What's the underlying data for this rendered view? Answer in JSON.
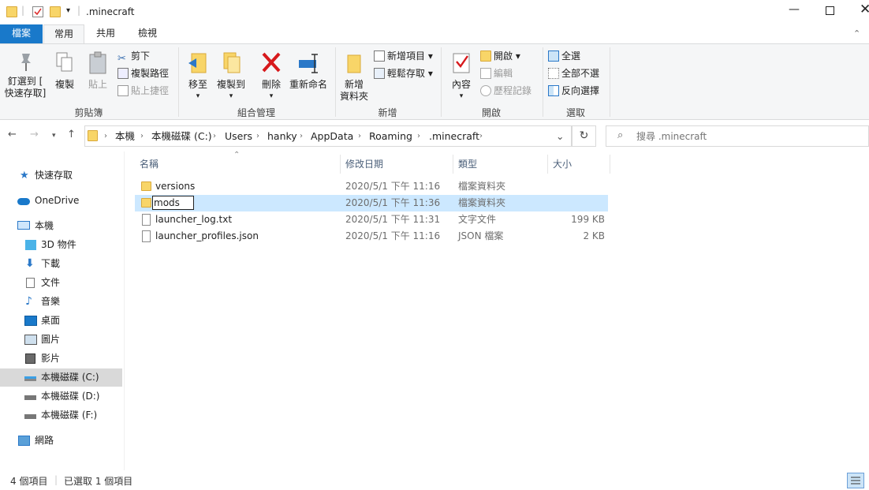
{
  "window": {
    "title": ".minecraft"
  },
  "ribbon_tabs": [
    "檔案",
    "常用",
    "共用",
    "檢視"
  ],
  "clipboard": {
    "pin_line1": "釘選到 [",
    "pin_line2": "快速存取]",
    "copy": "複製",
    "paste": "貼上",
    "cut": "剪下",
    "copy_path": "複製路徑",
    "paste_shortcut": "貼上捷徑",
    "group": "剪貼簿"
  },
  "organize": {
    "move_to": "移至",
    "copy_to": "複製到",
    "delete": "刪除",
    "rename": "重新命名",
    "group": "組合管理"
  },
  "new": {
    "new_folder_line1": "新增",
    "new_folder_line2": "資料夾",
    "new_item": "新增項目",
    "easy_access": "輕鬆存取",
    "group": "新增"
  },
  "open": {
    "properties": "內容",
    "open": "開啟",
    "edit": "編輯",
    "history": "歷程記錄",
    "group": "開啟"
  },
  "select": {
    "select_all": "全選",
    "select_none": "全部不選",
    "invert": "反向選擇",
    "group": "選取"
  },
  "breadcrumb": [
    "本機",
    "本機磁碟 (C:)",
    "Users",
    "hanky",
    "AppData",
    "Roaming",
    ".minecraft"
  ],
  "search": {
    "placeholder": "搜尋 .minecraft"
  },
  "columns": {
    "name": "名稱",
    "date": "修改日期",
    "type": "類型",
    "size": "大小"
  },
  "sidebar": {
    "quick_access": "快速存取",
    "onedrive": "OneDrive",
    "this_pc": "本機",
    "objects3d": "3D 物件",
    "downloads": "下載",
    "documents": "文件",
    "music": "音樂",
    "desktop": "桌面",
    "pictures": "圖片",
    "videos": "影片",
    "drive_c": "本機磁碟 (C:)",
    "drive_d": "本機磁碟 (D:)",
    "drive_f": "本機磁碟 (F:)",
    "network": "網路"
  },
  "files": [
    {
      "name": "versions",
      "date": "2020/5/1 下午 11:16",
      "type": "檔案資料夾",
      "size": ""
    },
    {
      "name": "mods",
      "date": "2020/5/1 下午 11:36",
      "type": "檔案資料夾",
      "size": ""
    },
    {
      "name": "launcher_log.txt",
      "date": "2020/5/1 下午 11:31",
      "type": "文字文件",
      "size": "199 KB"
    },
    {
      "name": "launcher_profiles.json",
      "date": "2020/5/1 下午 11:16",
      "type": "JSON 檔案",
      "size": "2 KB"
    }
  ],
  "status": {
    "count": "4 個項目",
    "selected": "已選取 1 個項目"
  },
  "colors": {
    "accent": "#1979ca",
    "selection": "#cce8ff",
    "folder": "#f8d568"
  }
}
